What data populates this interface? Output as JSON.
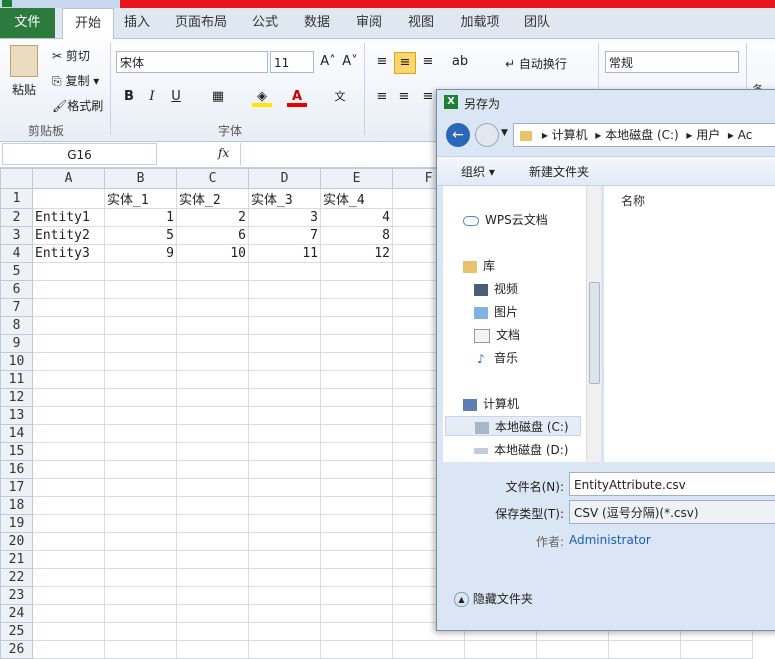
{
  "ribbon": {
    "tabs": [
      "文件",
      "开始",
      "插入",
      "页面布局",
      "公式",
      "数据",
      "审阅",
      "视图",
      "加载项",
      "团队"
    ],
    "clipboard": {
      "paste": "粘贴",
      "cut": "剪切",
      "copy": "复制",
      "format_painter": "格式刷",
      "group": "剪贴板"
    },
    "font": {
      "name": "宋体",
      "size": "11",
      "bold": "B",
      "italic": "I",
      "underline": "U",
      "group": "字体"
    },
    "alignment": {
      "wrap_text": "自动换行"
    },
    "number": {
      "format": "常规"
    },
    "styles": {
      "conditional": "条件"
    }
  },
  "formula_bar": {
    "name_box": "G16",
    "fx": "fx",
    "value": ""
  },
  "sheet": {
    "columns": [
      "A",
      "B",
      "C",
      "D",
      "E",
      "F"
    ],
    "rows": [
      [
        "",
        "实体_1",
        "实体_2",
        "实体_3",
        "实体_4"
      ],
      [
        "Entity1",
        "1",
        "2",
        "3",
        "4"
      ],
      [
        "Entity2",
        "5",
        "6",
        "7",
        "8"
      ],
      [
        "Entity3",
        "9",
        "10",
        "11",
        "12"
      ]
    ],
    "row_count": 26
  },
  "dialog": {
    "title": "另存为",
    "breadcrumb": [
      "计算机",
      "本地磁盘 (C:)",
      "用户",
      "Ac"
    ],
    "organize": "组织 ▾",
    "new_folder": "新建文件夹",
    "list_header": "名称",
    "nav": [
      "WPS云文档",
      "库",
      "视频",
      "图片",
      "文档",
      "音乐",
      "计算机",
      "本地磁盘 (C:)",
      "本地磁盘 (D:)"
    ],
    "filename_label": "文件名(N):",
    "filename": "EntityAttribute.csv",
    "filetype_label": "保存类型(T):",
    "filetype": "CSV (逗号分隔)(*.csv)",
    "author_label": "作者:",
    "author": "Administrator",
    "hide_folders": "隐藏文件夹"
  },
  "colors": {
    "file_tab": "#2d7a3d",
    "title_red": "#e8141b",
    "link_blue": "#1b5fb5"
  }
}
